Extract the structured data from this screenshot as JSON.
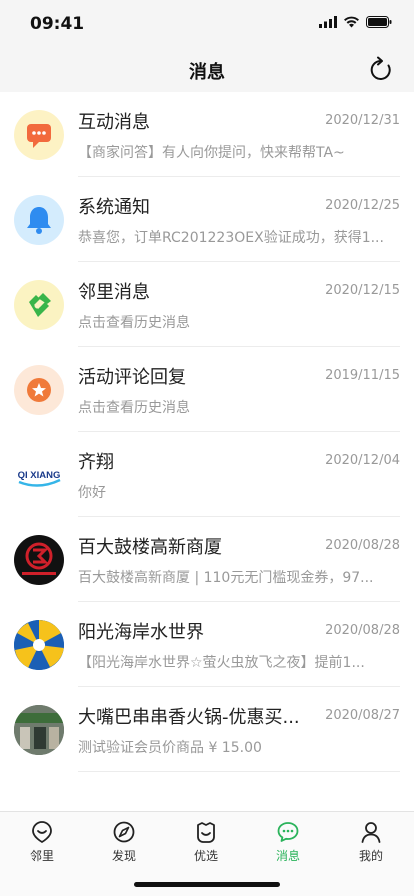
{
  "status": {
    "time": "09:41"
  },
  "header": {
    "title": "消息"
  },
  "messages": [
    {
      "title": "互动消息",
      "date": "2020/12/31",
      "preview": "【商家问答】有人向你提问，快来帮帮TA~",
      "icon": "chat-bubble-icon",
      "color": "#f26a3d"
    },
    {
      "title": "系统通知",
      "date": "2020/12/25",
      "preview": "恭喜您，订单RC201223OEX验证成功，获得1...",
      "icon": "bell-icon",
      "color": "#2f8cf0"
    },
    {
      "title": "邻里消息",
      "date": "2020/12/15",
      "preview": "点击查看历史消息",
      "icon": "handshake-icon",
      "color": "#39b54a"
    },
    {
      "title": "活动评论回复",
      "date": "2019/11/15",
      "preview": "点击查看历史消息",
      "icon": "star-badge-icon",
      "color": "#f07a3a"
    },
    {
      "title": "齐翔",
      "date": "2020/12/04",
      "preview": "你好",
      "icon": "qixiang-logo",
      "logo_text": "QI XIANG"
    },
    {
      "title": "百大鼓楼高新商厦",
      "date": "2020/08/28",
      "preview": "百大鼓楼高新商厦 | 110元无门槛现金券，97...",
      "icon": "store-logo"
    },
    {
      "title": "阳光海岸水世界",
      "date": "2020/08/28",
      "preview": "【阳光海岸水世界☆萤火虫放飞之夜】提前1...",
      "icon": "waterpark-logo"
    },
    {
      "title": "大嘴巴串串香火锅-优惠买...",
      "date": "2020/08/27",
      "preview": "测试验证会员价商品 ¥ 15.00",
      "icon": "restaurant-photo"
    }
  ],
  "tabbar": [
    {
      "label": "邻里",
      "icon": "neighborhood-icon",
      "active": false
    },
    {
      "label": "发现",
      "icon": "compass-icon",
      "active": false
    },
    {
      "label": "优选",
      "icon": "smile-bag-icon",
      "active": false
    },
    {
      "label": "消息",
      "icon": "message-icon",
      "active": true
    },
    {
      "label": "我的",
      "icon": "profile-icon",
      "active": false
    }
  ],
  "colors": {
    "accent": "#2ab35b"
  }
}
